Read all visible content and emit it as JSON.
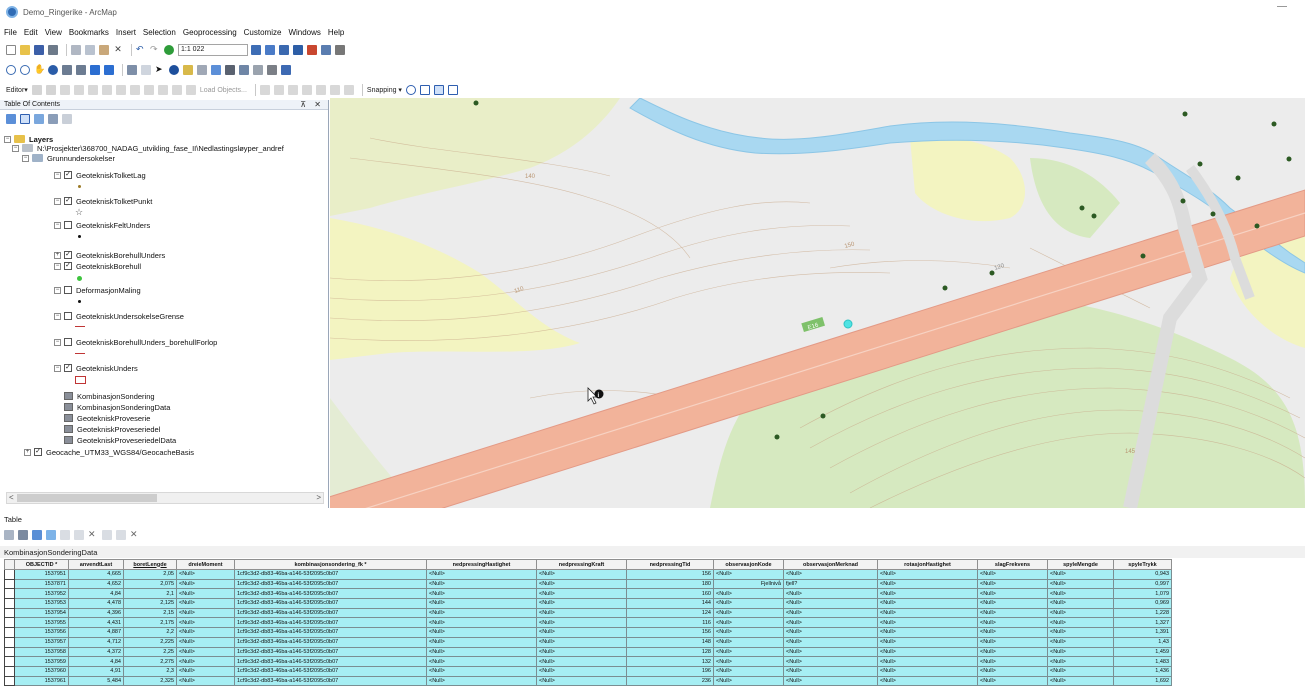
{
  "window": {
    "title": "Demo_Ringerike - ArcMap"
  },
  "menu": [
    "File",
    "Edit",
    "View",
    "Bookmarks",
    "Insert",
    "Selection",
    "Geoprocessing",
    "Customize",
    "Windows",
    "Help"
  ],
  "toolbar": {
    "scale": "1:1 022",
    "editor_label": "Editor▾",
    "load_objects": "Load Objects...",
    "snapping_label": "Snapping ▾"
  },
  "toc": {
    "title": "Table Of Contents",
    "pin_close": "⊼ ✕",
    "layers_label": "Layers",
    "source_path": "N:\\Prosjekter\\368700_NADAG_utvikling_fase_II\\Nedlastingsløyper_andref",
    "group_label": "Grunnundersokelser",
    "layers": [
      {
        "name": "GeotekniskTolketLag",
        "checked": true
      },
      {
        "name": "GeotekniskTolketPunkt",
        "checked": true
      },
      {
        "name": "GeotekniskFeltUnders",
        "checked": false
      },
      {
        "name": "GeotekniskBorehullUnders",
        "checked": true
      },
      {
        "name": "GeotekniskBorehull",
        "checked": true
      },
      {
        "name": "DeformasjonMaling",
        "checked": false
      },
      {
        "name": "GeotekniskUndersokelseGrense",
        "checked": false
      },
      {
        "name": "GeotekniskBorehullUnders_borehullForlop",
        "checked": false
      },
      {
        "name": "GeotekniskUnders",
        "checked": true
      }
    ],
    "tables": [
      "KombinasjonSondering",
      "KombinasjonSonderingData",
      "GeotekniskProveserie",
      "GeotekniskProveseriedel",
      "GeotekniskProveseriedelData"
    ],
    "basemap": "Geocache_UTM33_WGS84/GeocacheBasis",
    "scroll_left": "<",
    "scroll_right": ">"
  },
  "map": {
    "road_label": "E16",
    "contour_labels": [
      "150",
      "140",
      "110",
      "120",
      "145"
    ],
    "colors": {
      "road": "#f2b39a",
      "road_border": "#e39a86",
      "river": "#a9d8f1",
      "forest": "#f2f3c2",
      "green": "#d6e9c0",
      "background": "#ececec",
      "point": "#2c5a23",
      "selected": "#4fe3e3"
    }
  },
  "table_window": {
    "title": "Table",
    "tab_label": "KombinasjonSonderingData",
    "columns": [
      "OBJECTID *",
      "anvendtLast",
      "boretLengde",
      "dreieMoment",
      "kombinasjonsondering_fk *",
      "nedpressingHastighet",
      "nedpressingKraft",
      "nedpressingTid",
      "observasjonKode",
      "observasjonMerknad",
      "rotasjonHastighet",
      "slagFrekvens",
      "spyleMengde",
      "spyleTrykk"
    ],
    "rows": [
      [
        "1537951",
        "4,665",
        "2,05",
        "<Null>",
        "1cf9c3d2-db83-46ba-a146-53f2095c0b07",
        "<Null>",
        "<Null>",
        "156",
        "<Null>",
        "<Null>",
        "<Null>",
        "<Null>",
        "<Null>",
        "0,943"
      ],
      [
        "1537871",
        "4,652",
        "2,075",
        "<Null>",
        "1cf9c3d2-db83-46ba-a146-53f2095c0b07",
        "<Null>",
        "<Null>",
        "180",
        "Fjellnivå",
        "fjell?",
        "<Null>",
        "<Null>",
        "<Null>",
        "0,997"
      ],
      [
        "1537952",
        "4,84",
        "2,1",
        "<Null>",
        "1cf9c3d2-db83-46ba-a146-53f2095c0b07",
        "<Null>",
        "<Null>",
        "160",
        "<Null>",
        "<Null>",
        "<Null>",
        "<Null>",
        "<Null>",
        "1,079"
      ],
      [
        "1537953",
        "4,478",
        "2,125",
        "<Null>",
        "1cf9c3d2-db83-46ba-a146-53f2095c0b07",
        "<Null>",
        "<Null>",
        "144",
        "<Null>",
        "<Null>",
        "<Null>",
        "<Null>",
        "<Null>",
        "0,969"
      ],
      [
        "1537954",
        "4,396",
        "2,15",
        "<Null>",
        "1cf9c3d2-db83-46ba-a146-53f2095c0b07",
        "<Null>",
        "<Null>",
        "124",
        "<Null>",
        "<Null>",
        "<Null>",
        "<Null>",
        "<Null>",
        "1,228"
      ],
      [
        "1537955",
        "4,431",
        "2,175",
        "<Null>",
        "1cf9c3d2-db83-46ba-a146-53f2095c0b07",
        "<Null>",
        "<Null>",
        "116",
        "<Null>",
        "<Null>",
        "<Null>",
        "<Null>",
        "<Null>",
        "1,327"
      ],
      [
        "1537956",
        "4,887",
        "2,2",
        "<Null>",
        "1cf9c3d2-db83-46ba-a146-53f2095c0b07",
        "<Null>",
        "<Null>",
        "156",
        "<Null>",
        "<Null>",
        "<Null>",
        "<Null>",
        "<Null>",
        "1,391"
      ],
      [
        "1537957",
        "4,712",
        "2,225",
        "<Null>",
        "1cf9c3d2-db83-46ba-a146-53f2095c0b07",
        "<Null>",
        "<Null>",
        "148",
        "<Null>",
        "<Null>",
        "<Null>",
        "<Null>",
        "<Null>",
        "1,43"
      ],
      [
        "1537958",
        "4,372",
        "2,25",
        "<Null>",
        "1cf9c3d2-db83-46ba-a146-53f2095c0b07",
        "<Null>",
        "<Null>",
        "128",
        "<Null>",
        "<Null>",
        "<Null>",
        "<Null>",
        "<Null>",
        "1,459"
      ],
      [
        "1537959",
        "4,84",
        "2,275",
        "<Null>",
        "1cf9c3d2-db83-46ba-a146-53f2095c0b07",
        "<Null>",
        "<Null>",
        "132",
        "<Null>",
        "<Null>",
        "<Null>",
        "<Null>",
        "<Null>",
        "1,483"
      ],
      [
        "1537960",
        "4,91",
        "2,3",
        "<Null>",
        "1cf9c3d2-db83-46ba-a146-53f2095c0b07",
        "<Null>",
        "<Null>",
        "196",
        "<Null>",
        "<Null>",
        "<Null>",
        "<Null>",
        "<Null>",
        "1,436"
      ],
      [
        "1537961",
        "5,484",
        "2,325",
        "<Null>",
        "1cf9c3d2-db83-46ba-a146-53f2095c0b07",
        "<Null>",
        "<Null>",
        "236",
        "<Null>",
        "<Null>",
        "<Null>",
        "<Null>",
        "<Null>",
        "1,692"
      ]
    ]
  }
}
